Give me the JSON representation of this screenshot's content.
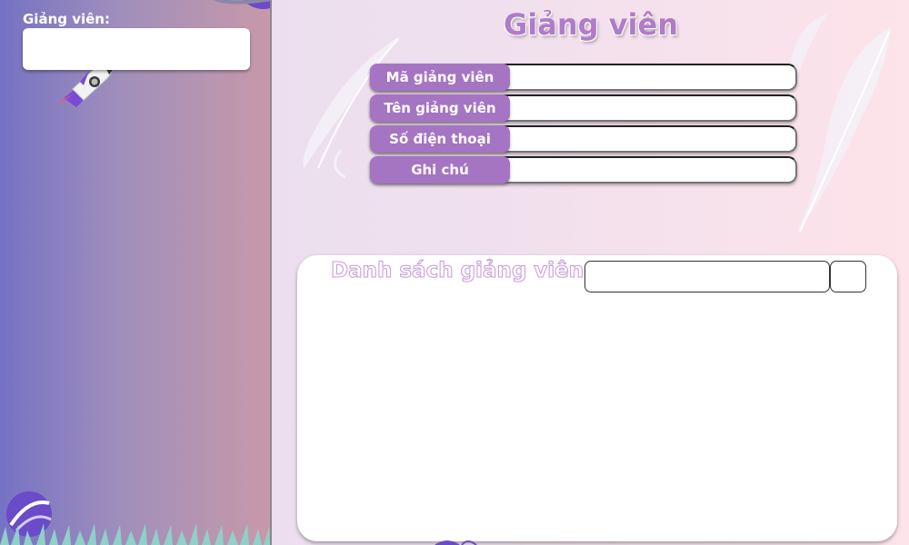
{
  "sidebar": {
    "label": "Giảng viên:",
    "input_value": ""
  },
  "header": {
    "title": "Giảng viên"
  },
  "form": {
    "fields": [
      {
        "label": "Mã giảng viên",
        "value": ""
      },
      {
        "label": "Tên giảng viên",
        "value": ""
      },
      {
        "label": "Số điện thoại",
        "value": ""
      },
      {
        "label": "Ghi chú",
        "value": ""
      }
    ]
  },
  "list": {
    "title": "Danh sách giảng viên",
    "search_value": ""
  },
  "colors": {
    "accent": "#a574c2",
    "title": "#b07cc8",
    "sidebar_start": "#7672c4",
    "sidebar_end": "#c899a8"
  }
}
